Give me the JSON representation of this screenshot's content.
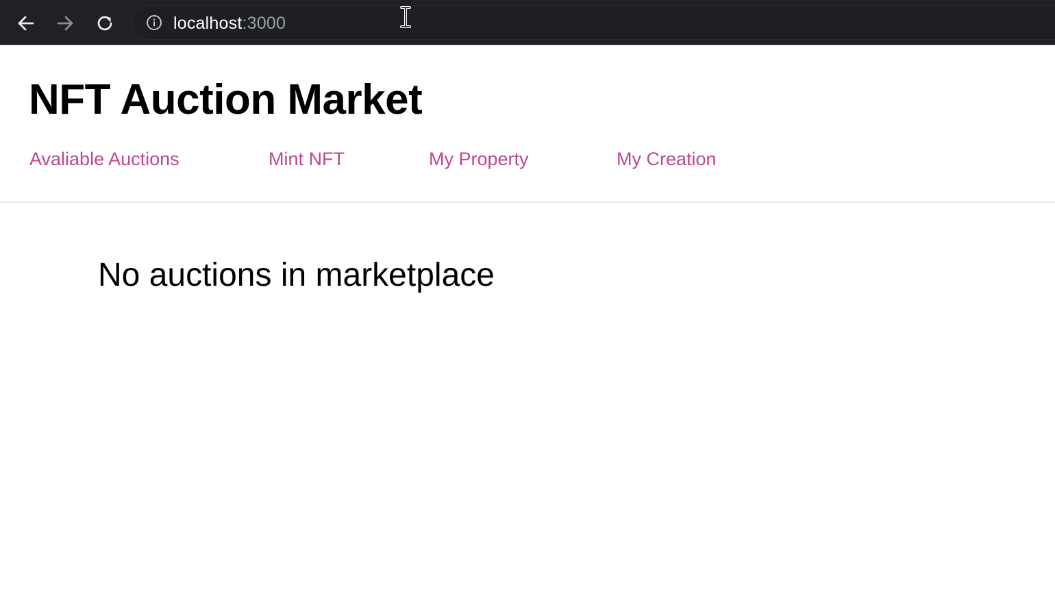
{
  "browser": {
    "url_host": "localhost",
    "url_port": ":3000",
    "icons": {
      "back": "arrow-left-icon",
      "forward": "arrow-right-icon",
      "reload": "reload-icon",
      "site_info": "info-circle-icon"
    }
  },
  "header": {
    "title": "NFT Auction Market",
    "nav": [
      {
        "label": "Avaliable Auctions"
      },
      {
        "label": "Mint NFT"
      },
      {
        "label": "My Property"
      },
      {
        "label": "My Creation"
      }
    ]
  },
  "main": {
    "empty_message": "No auctions in marketplace"
  },
  "colors": {
    "browser_bar": "#202124",
    "nav_link": "#c0468e",
    "title": "#000000"
  }
}
